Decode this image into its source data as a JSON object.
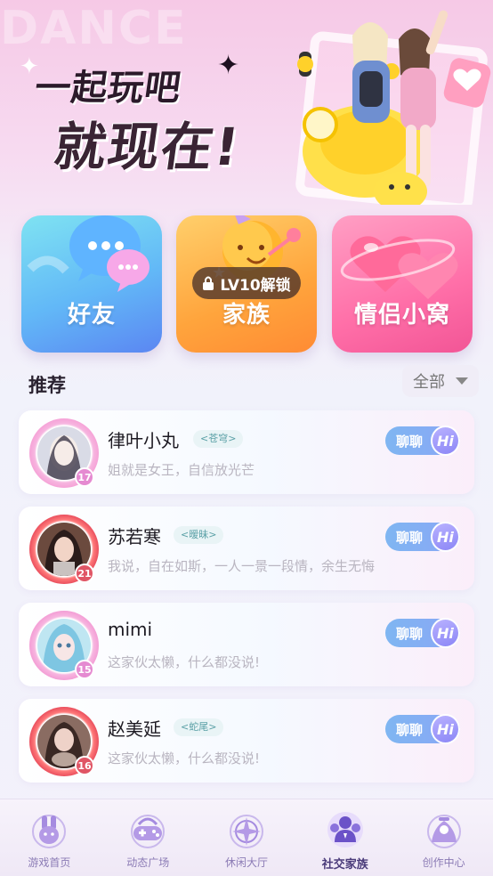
{
  "banner": {
    "bg_text": "DANCE",
    "title_line1": "一起玩吧",
    "title_line2": "就现在!"
  },
  "features": [
    {
      "label": "好友",
      "icon": "chat-bubbles-icon"
    },
    {
      "label": "家族",
      "icon": "party-ball-icon",
      "lock_text": "LV10解锁"
    },
    {
      "label": "情侣小窝",
      "icon": "hearts-icon"
    }
  ],
  "recommend": {
    "title": "推荐",
    "filter_label": "全部"
  },
  "friends": [
    {
      "name": "律叶小丸",
      "tag": "<苍穹>",
      "signature": "姐就是女王，自信放光芒",
      "level": "17",
      "chat_label": "聊聊",
      "hi_label": "Hi"
    },
    {
      "name": "苏若寒",
      "tag": "<暧昧>",
      "signature": "我说，自在如斯，一人一景一段情，余生无悔",
      "level": "21",
      "chat_label": "聊聊",
      "hi_label": "Hi"
    },
    {
      "name": "mimi",
      "tag": "",
      "signature": "这家伙太懒，什么都没说!",
      "level": "15",
      "chat_label": "聊聊",
      "hi_label": "Hi"
    },
    {
      "name": "赵美延",
      "tag": "<蛇尾>",
      "signature": "这家伙太懒，什么都没说!",
      "level": "16",
      "chat_label": "聊聊",
      "hi_label": "Hi"
    }
  ],
  "nav": [
    {
      "label": "游戏首页",
      "icon": "bunny-icon"
    },
    {
      "label": "动态广场",
      "icon": "gamepad-icon"
    },
    {
      "label": "休闲大厅",
      "icon": "compass-star-icon"
    },
    {
      "label": "社交家族",
      "icon": "people-icon",
      "active": true
    },
    {
      "label": "创作中心",
      "icon": "creator-icon"
    }
  ]
}
